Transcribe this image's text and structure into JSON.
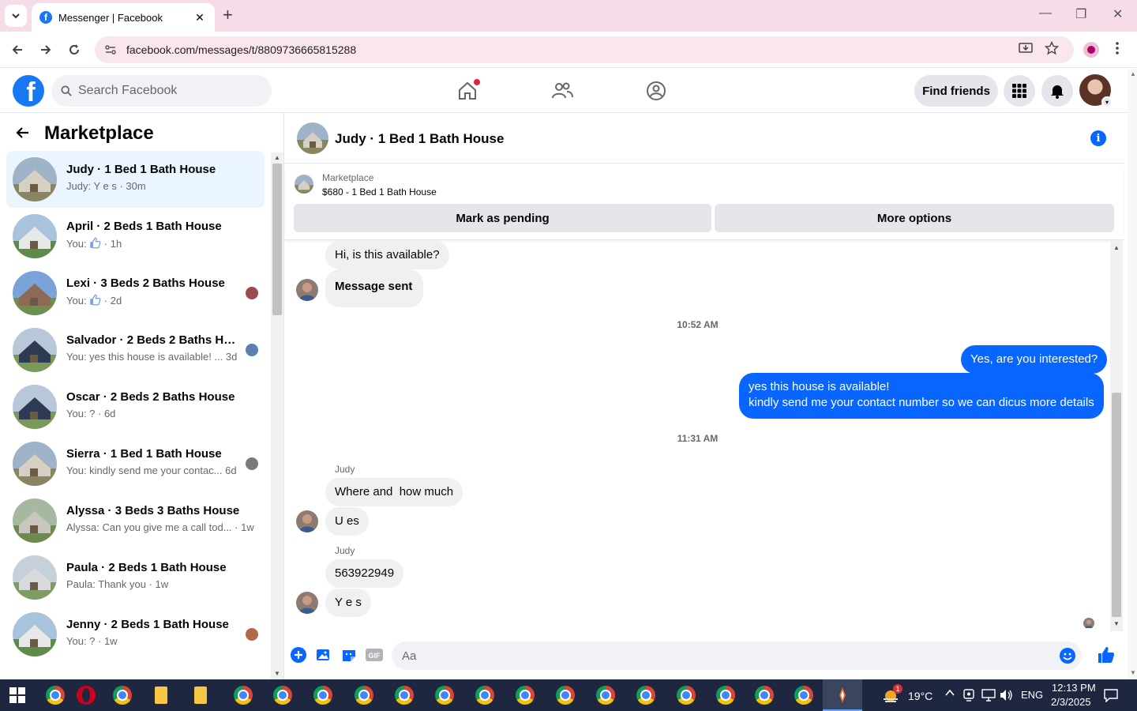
{
  "browser": {
    "tab_title": "Messenger | Facebook",
    "url": "facebook.com/messages/t/8809736665815288",
    "new_tab": "+",
    "tab_close": "✕",
    "minimize": "—",
    "restore": "❐",
    "close": "✕"
  },
  "fb": {
    "logo_letter": "f",
    "search_placeholder": "Search Facebook",
    "find_friends": "Find friends"
  },
  "sidebar": {
    "title": "Marketplace",
    "conversations": [
      {
        "name": "Judy · 1 Bed 1 Bath House",
        "snippet": "Judy: Y e s · 30m",
        "active": true
      },
      {
        "name": "April · 2 Beds 1 Bath House",
        "snippet_pre": "You: ",
        "snippet_post": " · 1h"
      },
      {
        "name": "Lexi · 3 Beds 2 Baths House",
        "snippet_pre": "You: ",
        "snippet_post": " · 2d"
      },
      {
        "name": "Salvador · 2 Beds 2 Baths Hou...",
        "snippet": "You: yes this house is available! ...  3d"
      },
      {
        "name": "Oscar · 2 Beds 2 Baths House",
        "snippet": "You: ? · 6d"
      },
      {
        "name": "Sierra · 1 Bed 1 Bath House",
        "snippet": "You: kindly send me your contac... 6d"
      },
      {
        "name": "Alyssa · 3 Beds 3 Baths House",
        "snippet": "Alyssa: Can you give me a call tod... · 1w"
      },
      {
        "name": "Paula · 2 Beds 1 Bath House",
        "snippet": "Paula: Thank you · 1w"
      },
      {
        "name": "Jenny · 2 Beds 1 Bath House",
        "snippet": "You: ? · 1w"
      }
    ]
  },
  "chat": {
    "title": "Judy · 1 Bed 1 Bath House",
    "listing_label": "Marketplace",
    "listing_price": "$680 - 1 Bed 1 Bath House",
    "mark_pending": "Mark as pending",
    "more_options": "More options",
    "messages": {
      "m1": "Hi, is this available?",
      "m2": "Message sent",
      "t1": "10:52 AM",
      "m3": "Yes, are you interested?",
      "m4": "yes this house is available!\nkindly send me your contact number so we can dicus more details",
      "t2": "11:31 AM",
      "sender1": "Judy",
      "m5": "Where and  how much",
      "m6": "U es",
      "sender2": "Judy",
      "m7": "563922949",
      "m8": "Y e s"
    },
    "composer_placeholder": "Aa"
  },
  "taskbar": {
    "weather": "19°C",
    "weather_badge": "1",
    "lang": "ENG",
    "time": "12:13 PM",
    "date": "2/3/2025"
  },
  "colors": {
    "fb_blue": "#1877f2",
    "messenger_blue": "#0866ff",
    "active_row": "#ebf5ff"
  }
}
